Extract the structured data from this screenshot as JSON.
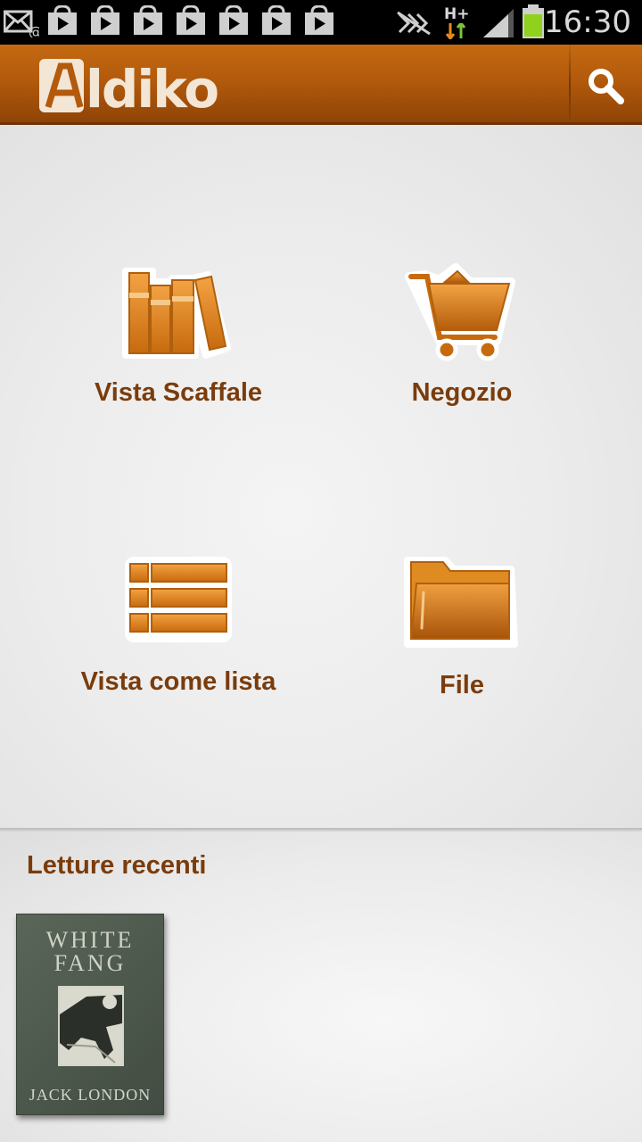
{
  "status_bar": {
    "time": "16:30",
    "network": "H+",
    "icons": [
      "email-icon",
      "play-store-icon",
      "play-store-icon",
      "play-store-icon",
      "play-store-icon",
      "play-store-icon",
      "play-store-icon",
      "play-store-icon",
      "nfc-icon",
      "signal-icon",
      "battery-icon"
    ]
  },
  "app_bar": {
    "logo_text": "Aldiko",
    "search_icon": "search-icon",
    "color": "#b35a0c"
  },
  "menu": {
    "items": [
      {
        "label": "Vista Scaffale",
        "icon": "bookshelf-icon"
      },
      {
        "label": "Negozio",
        "icon": "cart-icon"
      },
      {
        "label": "Vista come lista",
        "icon": "list-icon"
      },
      {
        "label": "File",
        "icon": "folder-icon"
      }
    ]
  },
  "recent": {
    "title": "Letture recenti",
    "books": [
      {
        "title_line1": "WHITE",
        "title_line2": "FANG",
        "author": "JACK LONDON"
      }
    ]
  },
  "colors": {
    "accent": "#e88a1a",
    "label": "#7a3c0c",
    "background": "#ececec"
  }
}
